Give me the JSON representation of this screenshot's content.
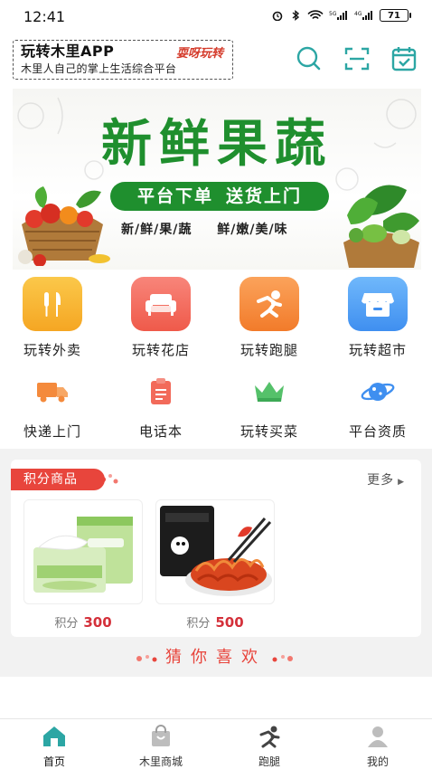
{
  "status_bar": {
    "time": "12:41",
    "battery": "71"
  },
  "header": {
    "app_name": "玩转木里APP",
    "logo_text": "耍呀玩转",
    "slogan": "木里人自己的掌上生活综合平台",
    "icons": [
      "search-icon",
      "scan-icon",
      "calendar-check-icon"
    ],
    "accent": "#2ca6a4"
  },
  "banner": {
    "title": "新鲜果蔬",
    "pill_left": "平台下单",
    "pill_right": "送货上门",
    "tags": [
      "新/鲜/果/蔬",
      "鲜/嫩/美/味"
    ],
    "brand_green": "#1f8f2e"
  },
  "services_primary": [
    {
      "label": "玩转外卖",
      "icon": "fork-knife-icon",
      "color": "#f7b733"
    },
    {
      "label": "玩转花店",
      "icon": "sofa-icon",
      "color": "#f26a5a"
    },
    {
      "label": "玩转跑腿",
      "icon": "runner-icon",
      "color": "#f48a3c"
    },
    {
      "label": "玩转超市",
      "icon": "store-icon",
      "color": "#4aa0f5"
    }
  ],
  "services_secondary": [
    {
      "label": "快递上门",
      "icon": "truck-icon"
    },
    {
      "label": "电话本",
      "icon": "notebook-icon"
    },
    {
      "label": "玩转买菜",
      "icon": "crown-icon"
    },
    {
      "label": "平台资质",
      "icon": "planet-icon"
    }
  ],
  "points": {
    "tag": "积分商品",
    "more": "更多",
    "price_prefix": "积分",
    "products": [
      {
        "points": "300",
        "image": "tissue-pack"
      },
      {
        "points": "500",
        "image": "spicy-noodles"
      }
    ],
    "accent": "#e8453c"
  },
  "guess": {
    "text": "猜你喜欢"
  },
  "tabbar": {
    "items": [
      {
        "label": "首页",
        "icon": "home-icon",
        "active": true
      },
      {
        "label": "木里商城",
        "icon": "shopping-bag-icon",
        "active": false
      },
      {
        "label": "跑腿",
        "icon": "runner-icon",
        "active": false
      },
      {
        "label": "我的",
        "icon": "user-icon",
        "active": false
      }
    ],
    "active_color": "#2ca6a4"
  }
}
